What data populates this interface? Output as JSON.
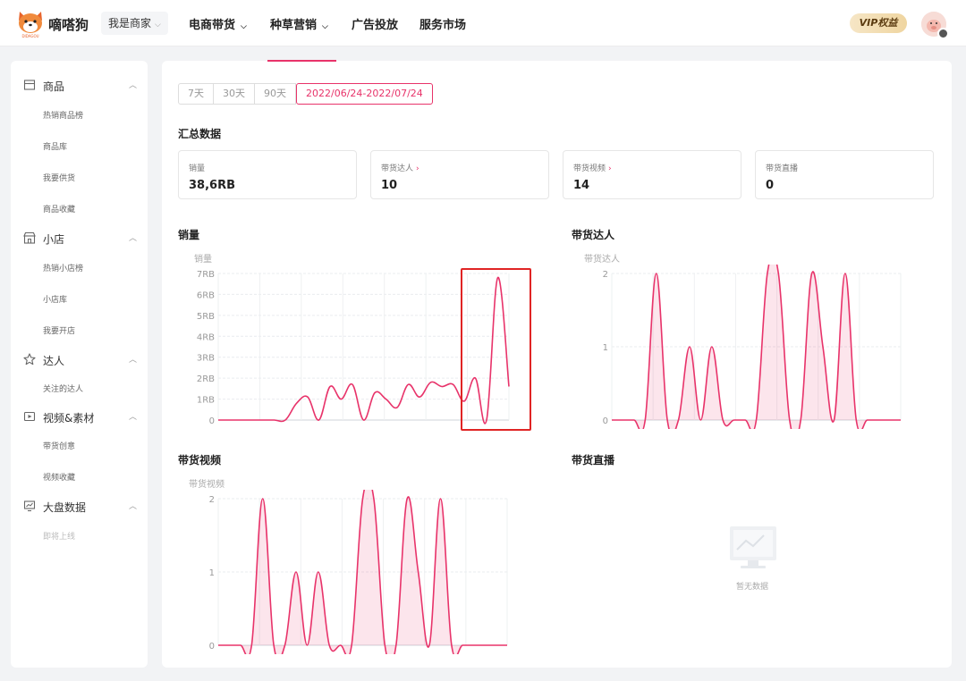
{
  "header": {
    "logo_text": "嘀嗒狗",
    "logo_subtext": "DIDAGOU",
    "role_label": "我是商家",
    "nav": [
      {
        "label": "电商带货",
        "has_dropdown": true
      },
      {
        "label": "种草营销",
        "has_dropdown": true
      },
      {
        "label": "广告投放",
        "has_dropdown": false
      },
      {
        "label": "服务市场",
        "has_dropdown": false
      }
    ],
    "vip_label": "VIP权益"
  },
  "sidebar": {
    "groups": [
      {
        "label": "商品",
        "icon": "box-icon",
        "items": [
          "热销商品榜",
          "商品库",
          "我要供货",
          "商品收藏"
        ]
      },
      {
        "label": "小店",
        "icon": "store-icon",
        "items": [
          "热销小店榜",
          "小店库",
          "我要开店"
        ]
      },
      {
        "label": "达人",
        "icon": "star-icon",
        "items": [
          "关注的达人"
        ]
      },
      {
        "label": "视频&素材",
        "icon": "video-icon",
        "items": [
          "带货创意",
          "视频收藏"
        ]
      },
      {
        "label": "大盘数据",
        "icon": "monitor-icon",
        "items": [
          "即将上线"
        ]
      }
    ]
  },
  "date_range": {
    "options": [
      "7天",
      "30天",
      "90天"
    ],
    "selected": "2022/06/24-2022/07/24"
  },
  "summary": {
    "title": "汇总数据",
    "cards": [
      {
        "label": "销量",
        "value": "38,6RB",
        "has_link": false
      },
      {
        "label": "带货达人",
        "value": "10",
        "has_link": true
      },
      {
        "label": "带货视频",
        "value": "14",
        "has_link": true
      },
      {
        "label": "带货直播",
        "value": "0",
        "has_link": false
      }
    ]
  },
  "empty_state": {
    "text": "暂无数据"
  },
  "colors": {
    "accent": "#e8336a",
    "highlight_box": "#e02424"
  },
  "chart_data": [
    {
      "type": "line",
      "title": "销量",
      "ylabel": "销量",
      "ylim": [
        0,
        7000
      ],
      "yticks": [
        0,
        1000,
        2000,
        3000,
        4000,
        5000,
        6000,
        7000
      ],
      "ytick_labels": [
        "0",
        "1RB",
        "2RB",
        "3RB",
        "4RB",
        "5RB",
        "6RB",
        "7RB"
      ],
      "fill": false,
      "grid": true,
      "series": [
        {
          "values": [
            0,
            0,
            0,
            0,
            0,
            0,
            0,
            800,
            1100,
            0,
            1600,
            1000,
            1700,
            0,
            1300,
            1000,
            600,
            1700,
            1100,
            1800,
            1600,
            1700,
            900,
            2000,
            0,
            6800,
            1600
          ]
        }
      ]
    },
    {
      "type": "area",
      "title": "带货达人",
      "ylabel": "带货达人",
      "ylim": [
        0,
        2
      ],
      "yticks": [
        0,
        1,
        2
      ],
      "ytick_labels": [
        "0",
        "1",
        "2"
      ],
      "fill": true,
      "grid": true,
      "series": [
        {
          "values": [
            0,
            0,
            0,
            0,
            2,
            0,
            0,
            1,
            0,
            1,
            0,
            0,
            0,
            0,
            2,
            2,
            0,
            0,
            2,
            1,
            0,
            2,
            0,
            0,
            0,
            0,
            0
          ]
        }
      ]
    },
    {
      "type": "area",
      "title": "带货视频",
      "ylabel": "带货视频",
      "ylim": [
        0,
        2
      ],
      "yticks": [
        0,
        1,
        2
      ],
      "ytick_labels": [
        "0",
        "1",
        "2"
      ],
      "fill": true,
      "grid": true,
      "series": [
        {
          "values": [
            0,
            0,
            0,
            0,
            2,
            0,
            0,
            1,
            0,
            1,
            0,
            0,
            0,
            2,
            2,
            0,
            0,
            2,
            1,
            0,
            2,
            0,
            0,
            0,
            0,
            0,
            0
          ]
        }
      ]
    },
    {
      "type": "line",
      "title": "带货直播",
      "series": []
    }
  ]
}
